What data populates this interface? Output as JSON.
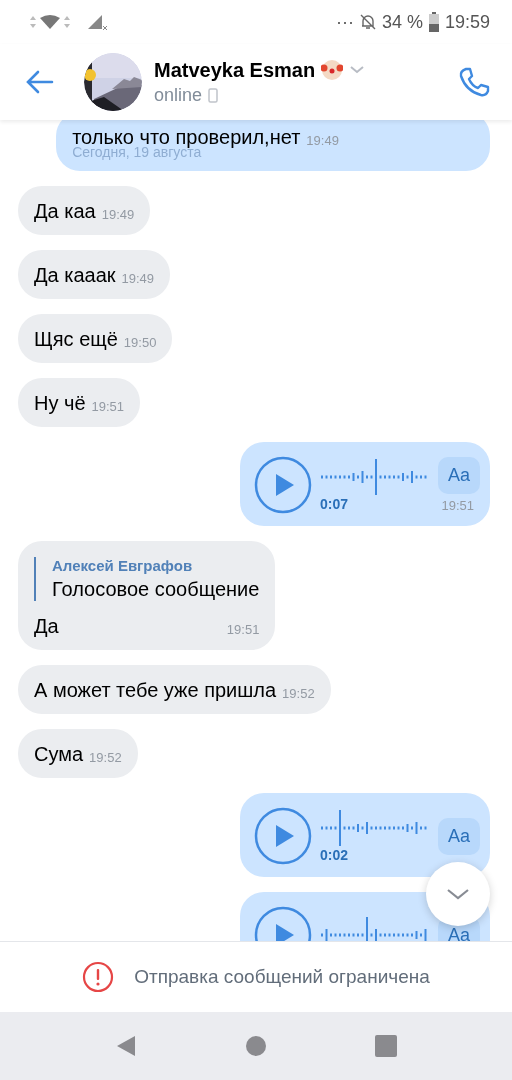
{
  "status_bar": {
    "dots": "···",
    "battery": "34 %",
    "time": "19:59"
  },
  "header": {
    "name": "Matveyka Esman",
    "status": "online"
  },
  "messages": [
    {
      "kind": "text",
      "outgoing": true,
      "text": "только что проверил,нет",
      "time": "19:49",
      "date": "Сегодня, 19 августа"
    },
    {
      "kind": "text",
      "outgoing": false,
      "text": "Да каа",
      "time": "19:49"
    },
    {
      "kind": "text",
      "outgoing": false,
      "text": "Да кааак",
      "time": "19:49"
    },
    {
      "kind": "text",
      "outgoing": false,
      "text": "Щяс ещё",
      "time": "19:50"
    },
    {
      "kind": "text",
      "outgoing": false,
      "text": "Ну чё",
      "time": "19:51"
    },
    {
      "kind": "voice",
      "outgoing": true,
      "duration": "0:07",
      "time": "19:51",
      "transcribe": "Aa"
    },
    {
      "kind": "reply",
      "outgoing": false,
      "author": "Алексей Евграфов",
      "quote": "Голосовое сообщение",
      "text": "Да",
      "time": "19:51"
    },
    {
      "kind": "text",
      "outgoing": false,
      "text": "А может тебе уже пришла",
      "time": "19:52"
    },
    {
      "kind": "text",
      "outgoing": false,
      "text": "Сума",
      "time": "19:52"
    },
    {
      "kind": "voice",
      "outgoing": true,
      "duration": "0:02",
      "transcribe": "Aa"
    },
    {
      "kind": "voice",
      "outgoing": true,
      "transcribe": "Aa"
    }
  ],
  "footer": {
    "notice": "Отправка сообщений ограничена"
  }
}
